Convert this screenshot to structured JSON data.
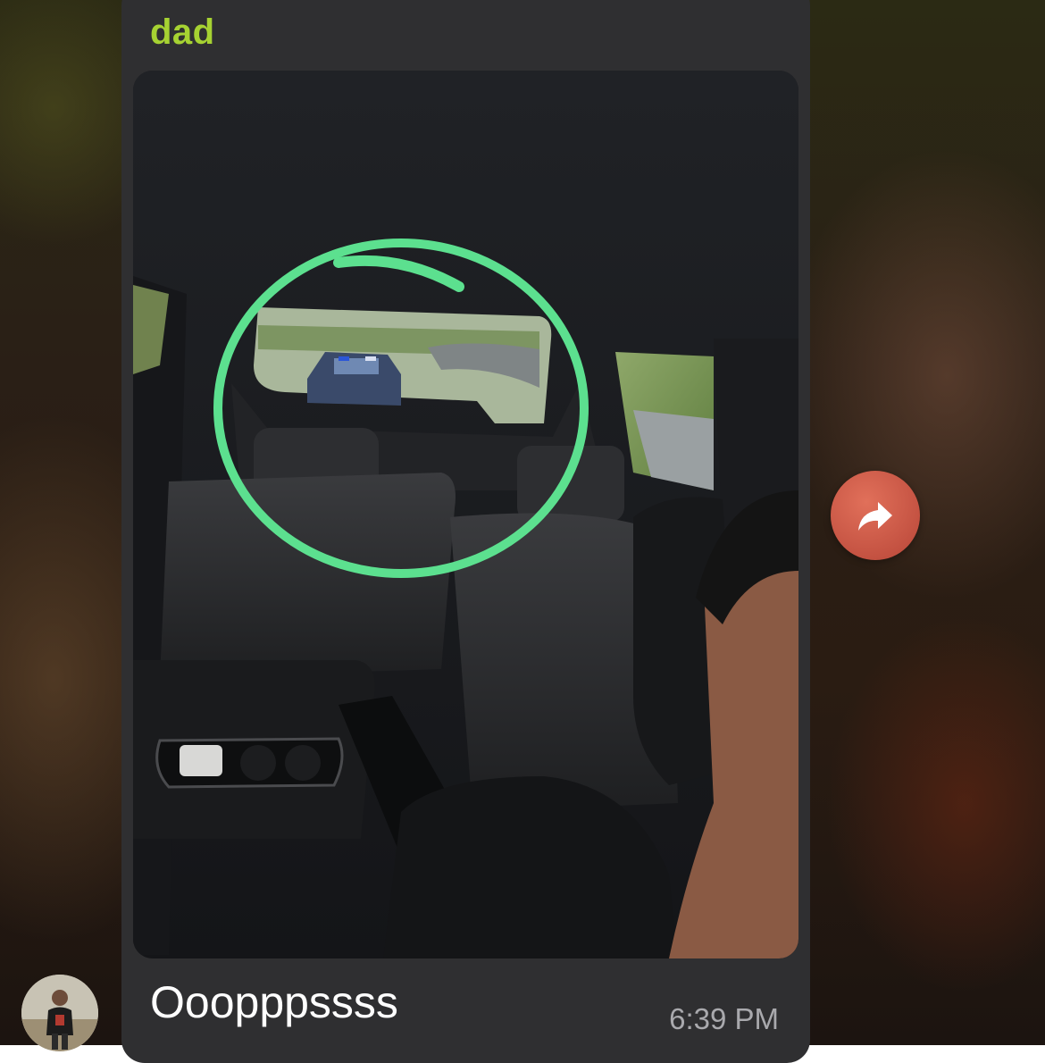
{
  "message": {
    "sender_name": "dad",
    "caption": "Ooopppssss",
    "time": "6:39 PM",
    "photo_icon": "photo-of-car-interior",
    "annotation_color": "#5ce08f"
  },
  "colors": {
    "sender_name": "#a6d232",
    "bubble": "#2f2f31",
    "forward_button": "#d2604b"
  },
  "icons": {
    "forward": "forward-arrow-icon",
    "avatar": "user-avatar"
  }
}
